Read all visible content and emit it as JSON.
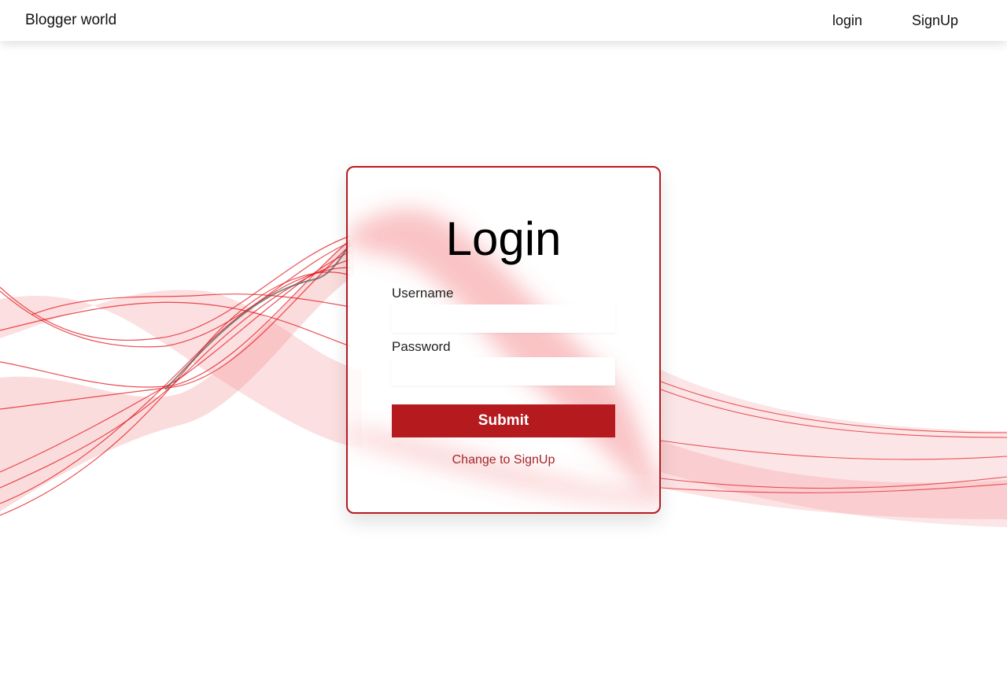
{
  "navbar": {
    "brand": "Blogger world",
    "links": [
      {
        "label": "login"
      },
      {
        "label": "SignUp"
      }
    ]
  },
  "login_card": {
    "title": "Login",
    "username_label": "Username",
    "username_value": "",
    "password_label": "Password",
    "password_value": "",
    "submit_label": "Submit",
    "switch_label": "Change to SignUp"
  },
  "colors": {
    "accent": "#b51a1f",
    "link": "#a3262b",
    "wave": "#e3141b"
  }
}
